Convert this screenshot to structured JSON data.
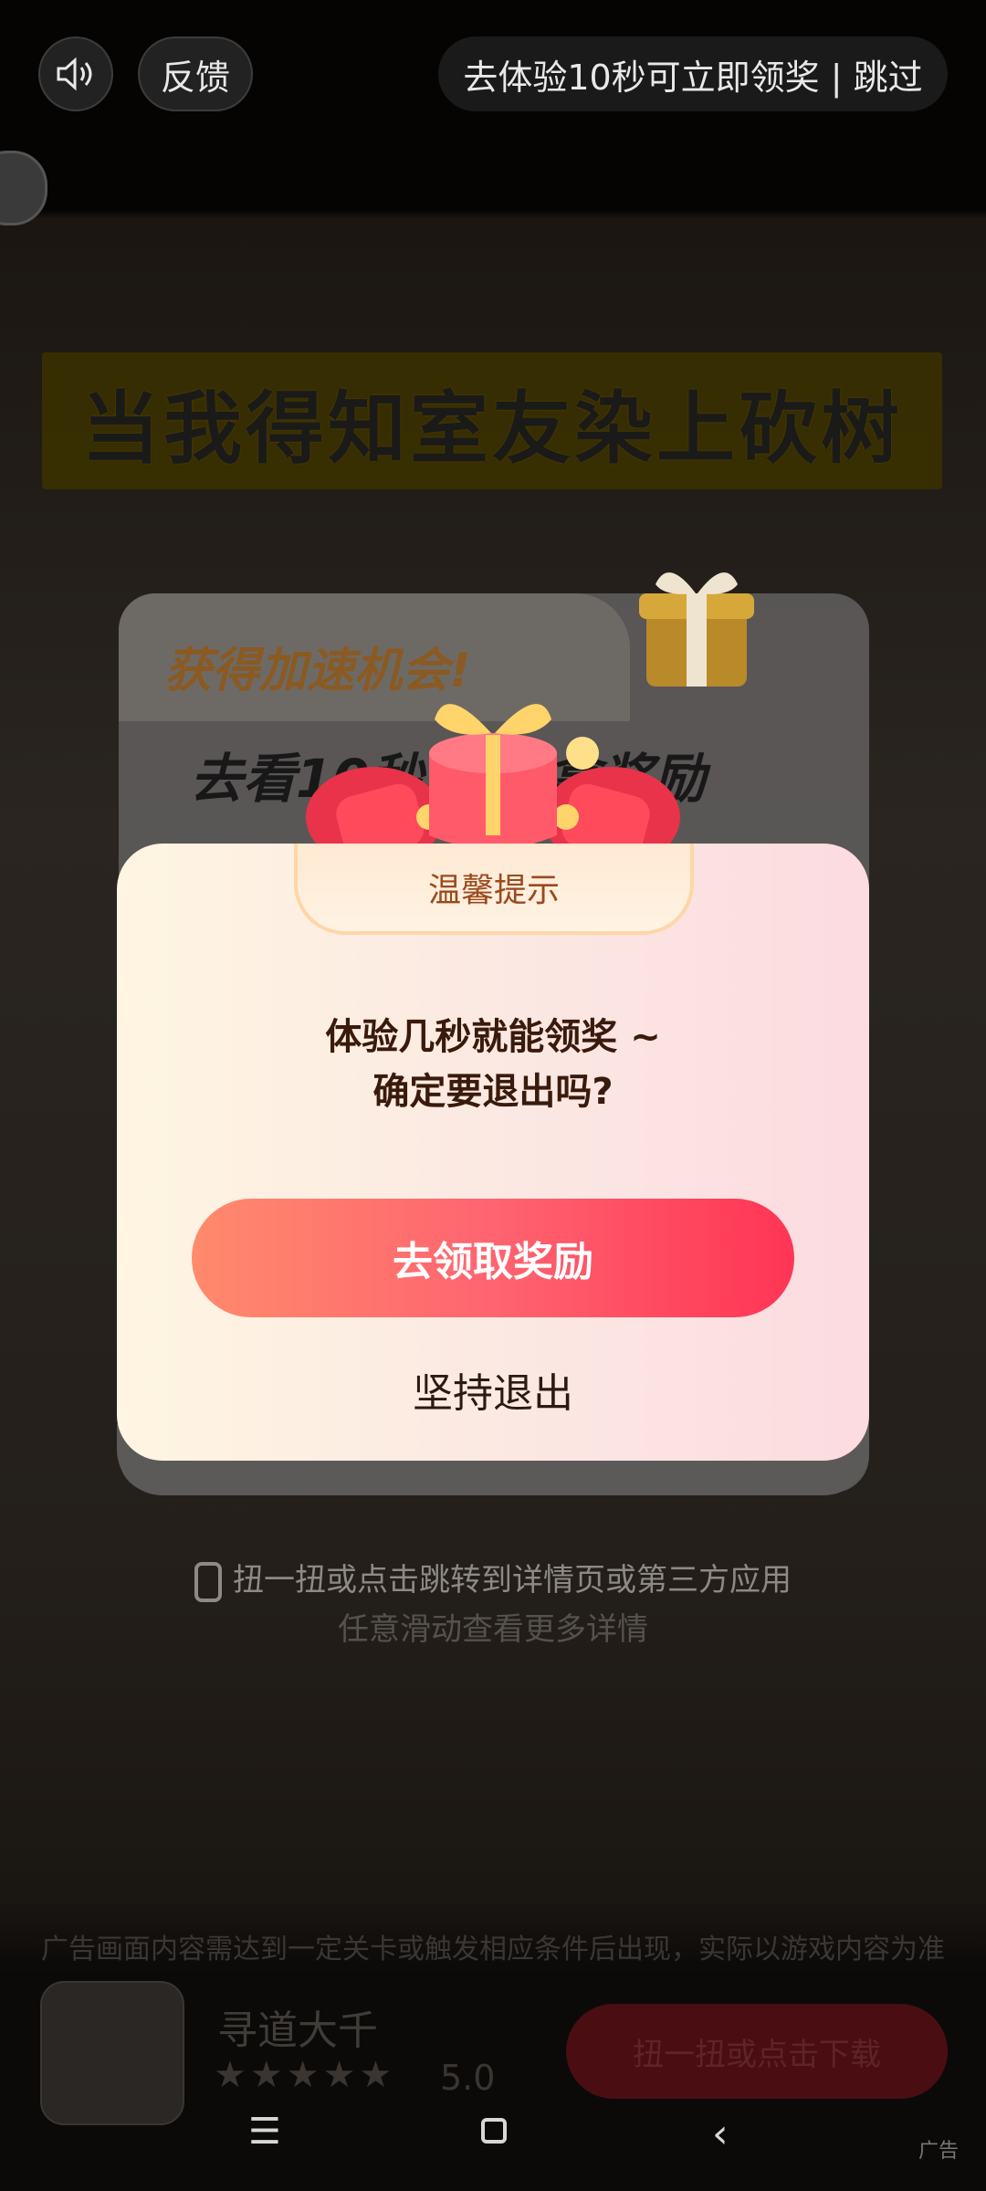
{
  "top_bar": {
    "feedback_label": "反馈",
    "skip_label": "去体验10秒可立即领奖 | 跳过"
  },
  "video": {
    "headline": "当我得知室友染上砍树"
  },
  "back_card": {
    "title1": "获得加速机会!",
    "title2": "去看10秒 直接拿奖励"
  },
  "dialog": {
    "tab_title": "温馨提示",
    "message_line1": "体验几秒就能领奖 ~",
    "message_line2": "确定要退出吗?",
    "claim_label": "去领取奖励",
    "quit_label": "坚持退出"
  },
  "hints": {
    "shake": "扭一扭或点击跳转到详情页或第三方应用",
    "swipe": "任意滑动查看更多详情"
  },
  "disclaimer": "广告画面内容需达到一定关卡或触发相应条件后出现，实际以游戏内容为准",
  "app": {
    "name": "寻道大千",
    "stars": "★★★★★",
    "rating": "5.0",
    "download_label": "扭一扭或点击下载"
  },
  "ad_label": "广告",
  "colors": {
    "claim_gradient_start": "#ff8a6c",
    "claim_gradient_end": "#ff3555",
    "dialog_bg": "#fdeee6"
  },
  "icons": [
    "speaker-icon",
    "gift-icon",
    "phone-shake-icon",
    "menu-icon",
    "home-icon",
    "back-icon"
  ]
}
